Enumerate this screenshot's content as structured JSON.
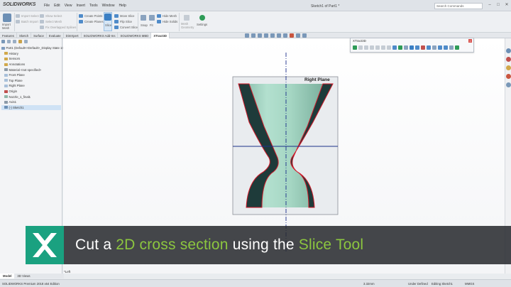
{
  "window": {
    "brand": "SOLIDWORKS",
    "title": "Sketch1 of Part1 *",
    "search_placeholder": "Search Commands",
    "menu": [
      "File",
      "Edit",
      "View",
      "Insert",
      "Tools",
      "Window",
      "Help"
    ]
  },
  "ribbon": {
    "groups": [
      {
        "label": "Import Mesh"
      },
      {
        "label": "Import Select"
      },
      {
        "label": "Batch Import"
      },
      {
        "label": "Show Select"
      },
      {
        "label": "Select Mesh"
      },
      {
        "label": "Fix Overlapped Splines"
      },
      {
        "label": "Create Points"
      },
      {
        "label": "Create Planes"
      },
      {
        "label": "Slice"
      },
      {
        "label": "Move Slice"
      },
      {
        "label": "Flip Slice"
      },
      {
        "label": "Convert Slice"
      },
      {
        "label": "Snap"
      },
      {
        "label": "Fit"
      },
      {
        "label": "Hide Mesh"
      },
      {
        "label": "Hide Solids"
      },
      {
        "label": "Mesh Geometry"
      },
      {
        "label": "Settings"
      }
    ]
  },
  "tabs": [
    {
      "label": "Features"
    },
    {
      "label": "Sketch"
    },
    {
      "label": "Surface"
    },
    {
      "label": "Evaluate"
    },
    {
      "label": "DimXpert"
    },
    {
      "label": "SOLIDWORKS Add-Ins"
    },
    {
      "label": "SOLIDWORKS MBD"
    },
    {
      "label": "XTract3D"
    }
  ],
  "tree": {
    "items": [
      {
        "label": "Part1 (Default<<Default>_Display State 1>)"
      },
      {
        "label": "History"
      },
      {
        "label": "Sensors"
      },
      {
        "label": "Annotations"
      },
      {
        "label": "Material <not specified>"
      },
      {
        "label": "Front Plane"
      },
      {
        "label": "Top Plane"
      },
      {
        "label": "Right Plane"
      },
      {
        "label": "Origin"
      },
      {
        "label": "Nozzle_1_final1"
      },
      {
        "label": "Axis1"
      },
      {
        "label": "(-) Sketch1"
      }
    ]
  },
  "viewport": {
    "plane_label": "Right Plane"
  },
  "xtract_toolbar": {
    "title": "XTract3D"
  },
  "bottom": {
    "tabs": [
      "Model",
      "3D Views"
    ],
    "active_tab": "*Left"
  },
  "status": {
    "left": "SOLIDWORKS Premium 2018 x64 Edition",
    "coord": "3.32mm",
    "state": "Under Defined",
    "editing": "Editing Sketch1",
    "units": "MMGS"
  },
  "caption": {
    "part1": "Cut a ",
    "part2": "2D cross section",
    "part3": " using the ",
    "part4": "Slice Tool"
  },
  "colors": {
    "accent_green": "#8cc63f",
    "logo_teal": "#1aa180",
    "mesh_teal": "#a7d8c6",
    "outline_red": "#d11a2a",
    "axis_blue": "#1c2f8a"
  }
}
